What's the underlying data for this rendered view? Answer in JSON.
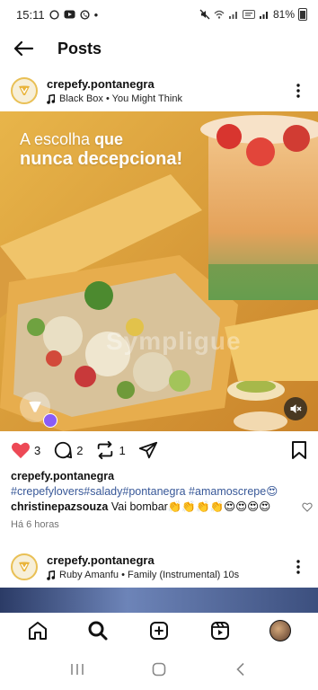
{
  "status_bar": {
    "time": "15:11",
    "dot": "•",
    "left_icons": [
      "whatsapp-icon",
      "youtube-icon",
      "phone-icon"
    ],
    "right_icons": [
      "mute-icon",
      "wifi-icon",
      "signal-icon",
      "volte-icon",
      "signal-icon"
    ],
    "battery": "81%"
  },
  "header": {
    "title": "Posts"
  },
  "post": {
    "username": "crepefy.pontanegra",
    "song": "Black Box • You Might Think",
    "image": {
      "headline_pre": "A escolha ",
      "headline_bold": "que",
      "headline_line2": "nunca decepciona!",
      "watermark": "Sympligue"
    },
    "likes": "3",
    "comments": "2",
    "shares": "1",
    "caption_username": "crepefy.pontanegra",
    "hashtags": "#crepefylovers#salady#pontanegra #amamoscrepe😍",
    "comment": {
      "username": "christinepazsouza",
      "text": " Vai bombar👏👏👏👏😍😍😍😍"
    },
    "time": "Há 6 horas"
  },
  "next_post": {
    "username": "crepefy.pontanegra",
    "song": "Ruby Amanfu • Family (Instrumental) 10s"
  },
  "colors": {
    "accent_blue": "#385898",
    "like_red": "#ed4956",
    "brand_yellow": "#e9c055"
  }
}
